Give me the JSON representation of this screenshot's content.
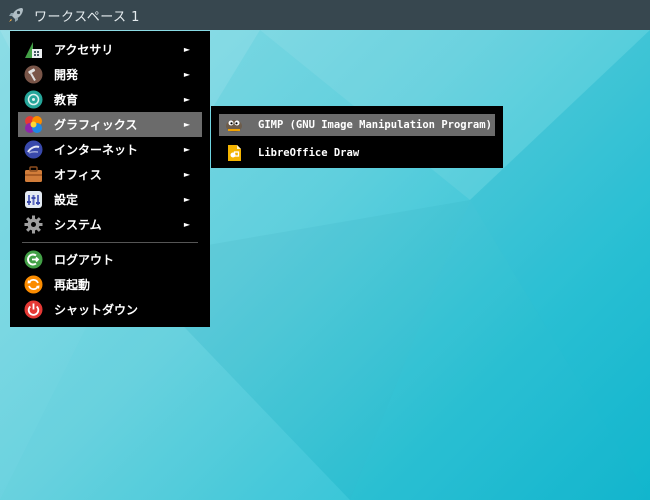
{
  "panel": {
    "workspace_label": "ワークスペース 1",
    "launcher_icon": "rocket-icon"
  },
  "menu": {
    "items": [
      {
        "label": "アクセサリ",
        "icon": "accessories-icon",
        "submenu": true
      },
      {
        "label": "開発",
        "icon": "development-icon",
        "submenu": true
      },
      {
        "label": "教育",
        "icon": "education-icon",
        "submenu": true
      },
      {
        "label": "グラフィックス",
        "icon": "graphics-icon",
        "submenu": true,
        "active": true
      },
      {
        "label": "インターネット",
        "icon": "internet-icon",
        "submenu": true
      },
      {
        "label": "オフィス",
        "icon": "office-icon",
        "submenu": true
      },
      {
        "label": "設定",
        "icon": "settings-icon",
        "submenu": true
      },
      {
        "label": "システム",
        "icon": "system-icon",
        "submenu": true
      }
    ],
    "session": [
      {
        "label": "ログアウト",
        "icon": "logout-icon"
      },
      {
        "label": "再起動",
        "icon": "reboot-icon"
      },
      {
        "label": "シャットダウン",
        "icon": "shutdown-icon"
      }
    ],
    "arrow": "►"
  },
  "submenu": {
    "items": [
      {
        "label": "GIMP (GNU Image Manipulation Program)",
        "icon": "gimp-icon",
        "active": true
      },
      {
        "label": "LibreOffice Draw",
        "icon": "libreoffice-draw-icon"
      }
    ]
  },
  "colors": {
    "panel": "#37474f",
    "menu_bg": "#000000",
    "highlight": "#6b6b6b",
    "desktop": "#2ec3d6"
  }
}
